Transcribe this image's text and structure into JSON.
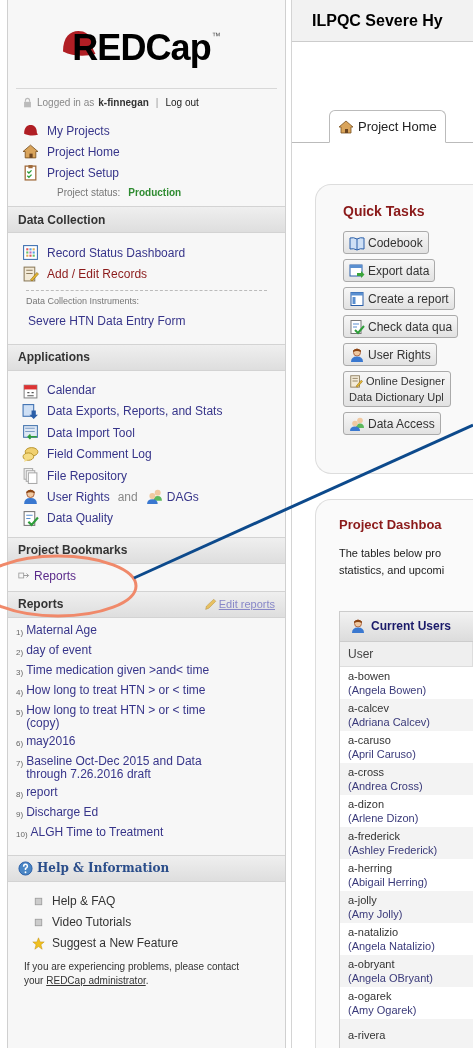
{
  "logo": {
    "text": "REDCap",
    "mark": "™"
  },
  "login": {
    "prefix": "Logged in as",
    "user": "k-finnegan",
    "separator": "|",
    "logout": "Log out"
  },
  "top_links": [
    "My Projects",
    "Project Home",
    "Project Setup"
  ],
  "project_status": {
    "label": "Project status:",
    "value": "Production"
  },
  "data_collection": {
    "title": "Data Collection",
    "links": [
      {
        "label": "Record Status Dashboard",
        "kind": "normal"
      },
      {
        "label": "Add / Edit Records",
        "kind": "accent"
      }
    ],
    "instruments_label": "Data Collection Instruments:",
    "instruments": [
      "Severe HTN Data Entry Form"
    ]
  },
  "applications": {
    "title": "Applications",
    "items": [
      {
        "label": "Calendar"
      },
      {
        "label": "Data Exports, Reports, and Stats"
      },
      {
        "label": "Data Import Tool"
      },
      {
        "label": "Field Comment Log"
      },
      {
        "label": "File Repository"
      },
      {
        "label": "User Rights",
        "joiner": "and",
        "label2": "DAGs"
      },
      {
        "label": "Data Quality"
      }
    ]
  },
  "bookmarks": {
    "title": "Project Bookmarks",
    "items": [
      "Reports"
    ]
  },
  "reports": {
    "title": "Reports",
    "edit": "Edit reports",
    "items": [
      {
        "number": "1)",
        "label": "Maternal Age"
      },
      {
        "number": "2)",
        "label": "day of event"
      },
      {
        "number": "3)",
        "label": "Time medication given >and< time"
      },
      {
        "number": "4)",
        "label": "How long to treat HTN > or < time"
      },
      {
        "number": "5)",
        "label": "How long to treat HTN > or < time (copy)"
      },
      {
        "number": "6)",
        "label": "may2016"
      },
      {
        "number": "7)",
        "label": "Baseline Oct-Dec 2015 and Data through 7.26.2016 draft"
      },
      {
        "number": "8)",
        "label": "report"
      },
      {
        "number": "9)",
        "label": "Discharge Ed"
      },
      {
        "number": "10)",
        "label": "ALGH Time to Treatment"
      }
    ]
  },
  "help": {
    "title": "Help & Information",
    "items": [
      {
        "label": "Help & FAQ",
        "kind": "bullet"
      },
      {
        "label": "Video Tutorials",
        "kind": "bullet"
      },
      {
        "label": "Suggest a New Feature",
        "kind": "star"
      }
    ],
    "note": "If you are experiencing problems, please contact your",
    "note_link": "REDCap administrator",
    "note_end": "."
  },
  "header": {
    "title": "ILPQC Severe Hy"
  },
  "tabs": [
    {
      "label": "Project Home",
      "selected": true
    }
  ],
  "quick_tasks": {
    "title": "Quick Tasks",
    "buttons": [
      {
        "lines": [
          "Codebook"
        ]
      },
      {
        "lines": [
          "Export data"
        ]
      },
      {
        "lines": [
          "Create a report"
        ]
      },
      {
        "lines": [
          "Check data qua"
        ]
      },
      {
        "lines": [
          "User Rights"
        ]
      },
      {
        "lines": [
          "Online Designer",
          "Data Dictionary Upl"
        ]
      },
      {
        "lines": [
          "Data Access"
        ]
      }
    ]
  },
  "dashboard": {
    "title": "Project Dashboa",
    "intro": [
      "The tables below pro",
      "statistics, and upcomi"
    ]
  },
  "users_table": {
    "title": "Current Users",
    "columns": [
      "User"
    ],
    "rows": [
      {
        "username": "a-bowen",
        "full_name": "(Angela Bowen)"
      },
      {
        "username": "a-calcev",
        "full_name": "(Adriana Calcev)"
      },
      {
        "username": "a-caruso",
        "full_name": "(April Caruso)"
      },
      {
        "username": "a-cross",
        "full_name": "(Andrea Cross)"
      },
      {
        "username": "a-dizon",
        "full_name": "(Arlene Dizon)"
      },
      {
        "username": "a-frederick",
        "full_name": "(Ashley Frederick)"
      },
      {
        "username": "a-herring",
        "full_name": "(Abigail Herring)"
      },
      {
        "username": "a-jolly",
        "full_name": "(Amy Jolly)"
      },
      {
        "username": "a-natalizio",
        "full_name": "(Angela Natalizio)"
      },
      {
        "username": "a-obryant",
        "full_name": "(Angela OBryant)"
      },
      {
        "username": "a-ogarek",
        "full_name": "(Amy Ogarek)"
      },
      {
        "username": "a-rivera"
      }
    ]
  },
  "annotations": [
    {
      "kind": "ellipse"
    },
    {
      "kind": "line"
    }
  ]
}
